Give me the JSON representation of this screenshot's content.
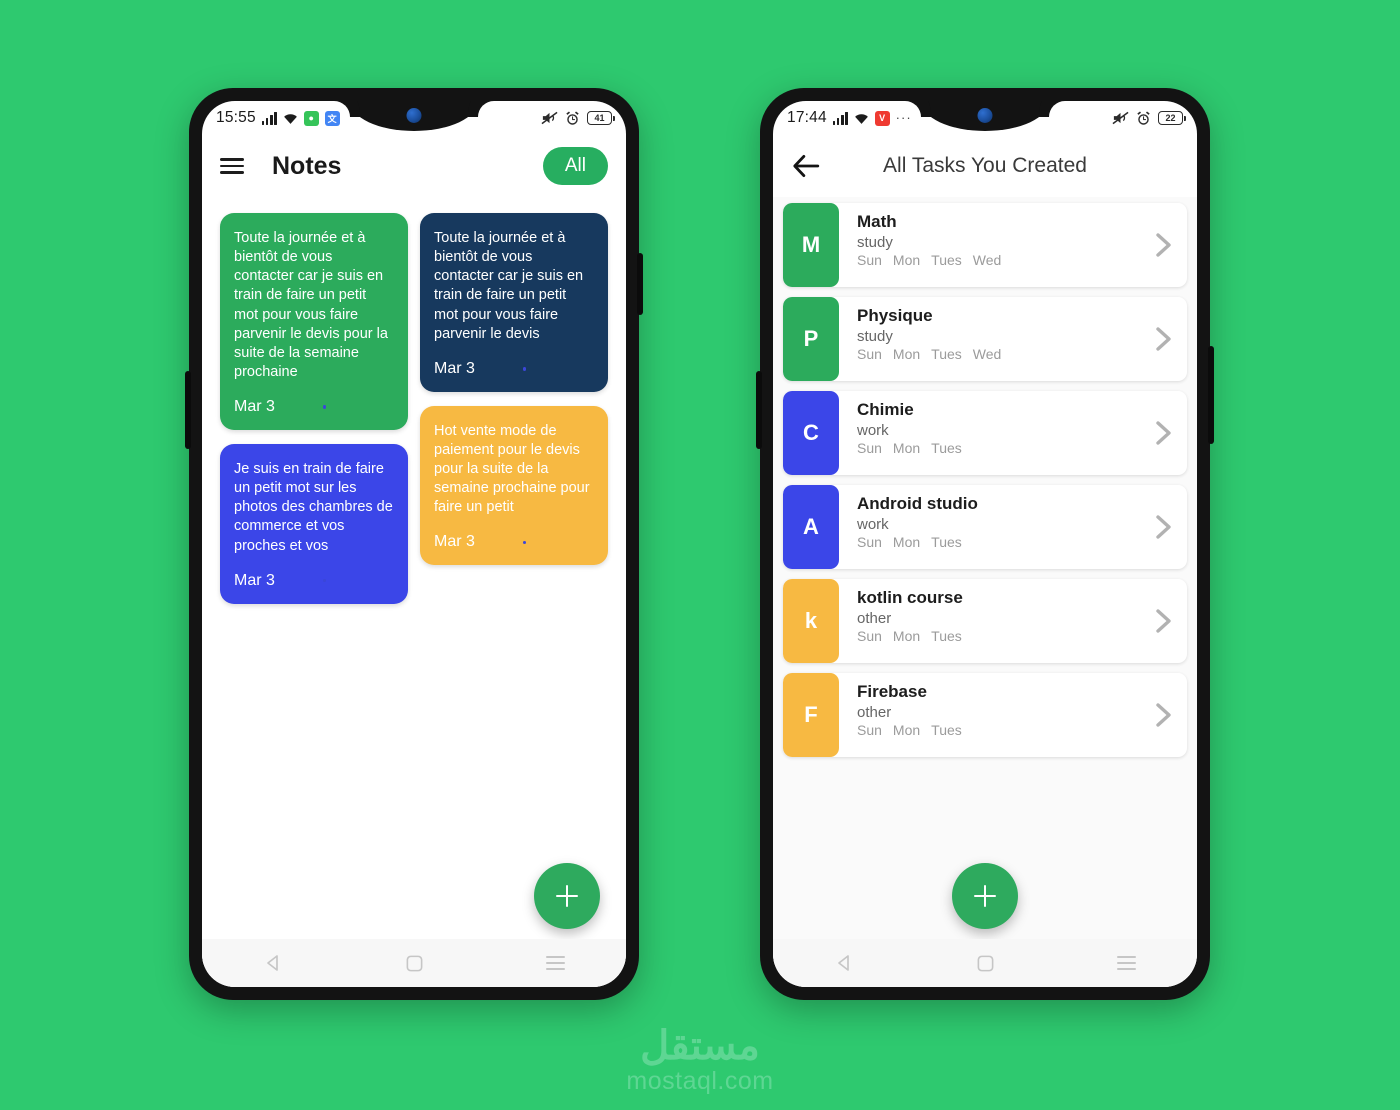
{
  "background_color": "#2ec96f",
  "phones": {
    "left": {
      "status_bar": {
        "time": "15:55",
        "icons": [
          "signal-icon",
          "wifi-icon",
          "whatsapp-badge-icon",
          "translate-badge-icon"
        ],
        "right_icons": [
          "mute-icon",
          "alarm-icon"
        ],
        "battery": "41"
      },
      "app_bar": {
        "menu_icon": "hamburger-icon",
        "title": "Notes",
        "filter_label": "All"
      },
      "notes": [
        {
          "text": "Toute la journée et à bientôt de vous contacter car je suis en train de faire un petit mot pour vous faire parvenir le devis pour la suite de la semaine prochaine",
          "date": "Mar 3",
          "color": "#2cab5c",
          "column": 0
        },
        {
          "text": "Je suis en train de faire un petit mot sur les photos des chambres de commerce et vos proches et vos",
          "date": "Mar 3",
          "color": "#3b46e8",
          "column": 0
        },
        {
          "text": "Toute la journée et à bientôt de vous contacter car je suis en train de faire un petit mot pour vous faire parvenir le devis",
          "date": "Mar 3",
          "color": "#17395e",
          "column": 1
        },
        {
          "text": "Hot vente mode de paiement pour le devis pour la suite de la semaine prochaine pour faire un petit",
          "date": "Mar 3",
          "color": "#f7b942",
          "column": 1
        }
      ],
      "fab_label": "add-note",
      "nav": [
        "back-icon",
        "home-icon",
        "recents-icon"
      ]
    },
    "right": {
      "status_bar": {
        "time": "17:44",
        "icons": [
          "signal-icon",
          "wifi-icon",
          "vivaldi-badge-icon",
          "more-dots-icon"
        ],
        "right_icons": [
          "mute-icon",
          "alarm-icon"
        ],
        "battery": "22"
      },
      "app_bar": {
        "back_icon": "back-arrow-icon",
        "title": "All Tasks You Created"
      },
      "tasks": [
        {
          "initial": "M",
          "title": "Math",
          "category": "study",
          "days": [
            "Sun",
            "Mon",
            "Tues",
            "Wed"
          ],
          "color": "#2cab5c"
        },
        {
          "initial": "P",
          "title": "Physique",
          "category": "study",
          "days": [
            "Sun",
            "Mon",
            "Tues",
            "Wed"
          ],
          "color": "#2cab5c"
        },
        {
          "initial": "C",
          "title": "Chimie",
          "category": "work",
          "days": [
            "Sun",
            "Mon",
            "Tues"
          ],
          "color": "#3b46e8"
        },
        {
          "initial": "A",
          "title": "Android studio",
          "category": "work",
          "days": [
            "Sun",
            "Mon",
            "Tues"
          ],
          "color": "#3b46e8"
        },
        {
          "initial": "k",
          "title": "kotlin course",
          "category": "other",
          "days": [
            "Sun",
            "Mon",
            "Tues"
          ],
          "color": "#f7b942"
        },
        {
          "initial": "F",
          "title": "Firebase",
          "category": "other",
          "days": [
            "Sun",
            "Mon",
            "Tues"
          ],
          "color": "#f7b942"
        }
      ],
      "fab_label": "add-task",
      "nav": [
        "back-icon",
        "home-icon",
        "recents-icon"
      ]
    }
  },
  "watermark": {
    "arabic": "مستقل",
    "latin": "mostaql.com"
  }
}
